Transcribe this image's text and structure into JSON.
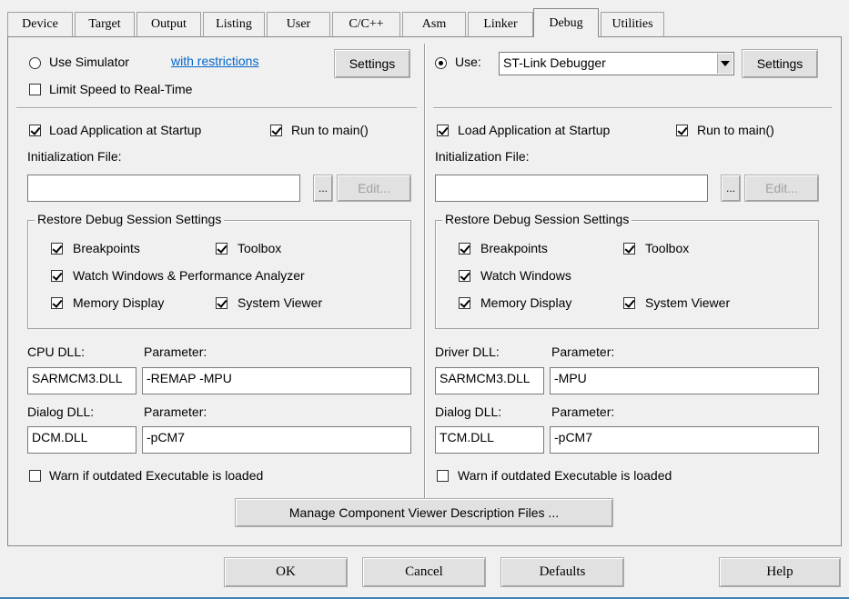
{
  "tabs": [
    "Device",
    "Target",
    "Output",
    "Listing",
    "User",
    "C/C++",
    "Asm",
    "Linker",
    "Debug",
    "Utilities"
  ],
  "active_tab": "Debug",
  "left": {
    "use_simulator_label": "Use Simulator",
    "with_restrictions_link": "with restrictions",
    "settings_label": "Settings",
    "limit_speed_label": "Limit Speed to Real-Time",
    "load_app_label": "Load Application at Startup",
    "run_to_main_label": "Run to main()",
    "init_file_label": "Initialization File:",
    "init_file_value": "",
    "browse_label": "...",
    "edit_label": "Edit...",
    "restore_title": "Restore Debug Session Settings",
    "breakpoints_label": "Breakpoints",
    "toolbox_label": "Toolbox",
    "watch_label": "Watch Windows & Performance Analyzer",
    "memory_label": "Memory Display",
    "system_viewer_label": "System Viewer",
    "cpu_dll_label": "CPU DLL:",
    "param1_label": "Parameter:",
    "cpu_dll_value": "SARMCM3.DLL",
    "param1_value": "-REMAP -MPU",
    "dialog_dll_label": "Dialog DLL:",
    "param2_label": "Parameter:",
    "dialog_dll_value": "DCM.DLL",
    "param2_value": "-pCM7",
    "warn_label": "Warn if outdated Executable is loaded"
  },
  "right": {
    "use_label": "Use:",
    "debugger_value": "ST-Link Debugger",
    "settings_label": "Settings",
    "load_app_label": "Load Application at Startup",
    "run_to_main_label": "Run to main()",
    "init_file_label": "Initialization File:",
    "init_file_value": "",
    "browse_label": "...",
    "edit_label": "Edit...",
    "restore_title": "Restore Debug Session Settings",
    "breakpoints_label": "Breakpoints",
    "toolbox_label": "Toolbox",
    "watch_label": "Watch Windows",
    "memory_label": "Memory Display",
    "system_viewer_label": "System Viewer",
    "driver_dll_label": "Driver DLL:",
    "param1_label": "Parameter:",
    "driver_dll_value": "SARMCM3.DLL",
    "param1_value": "-MPU",
    "dialog_dll_label": "Dialog DLL:",
    "param2_label": "Parameter:",
    "dialog_dll_value": "TCM.DLL",
    "param2_value": "-pCM7",
    "warn_label": "Warn if outdated Executable is loaded"
  },
  "manage_button": "Manage Component Viewer Description Files ...",
  "footer": {
    "ok": "OK",
    "cancel": "Cancel",
    "defaults": "Defaults",
    "help": "Help"
  }
}
